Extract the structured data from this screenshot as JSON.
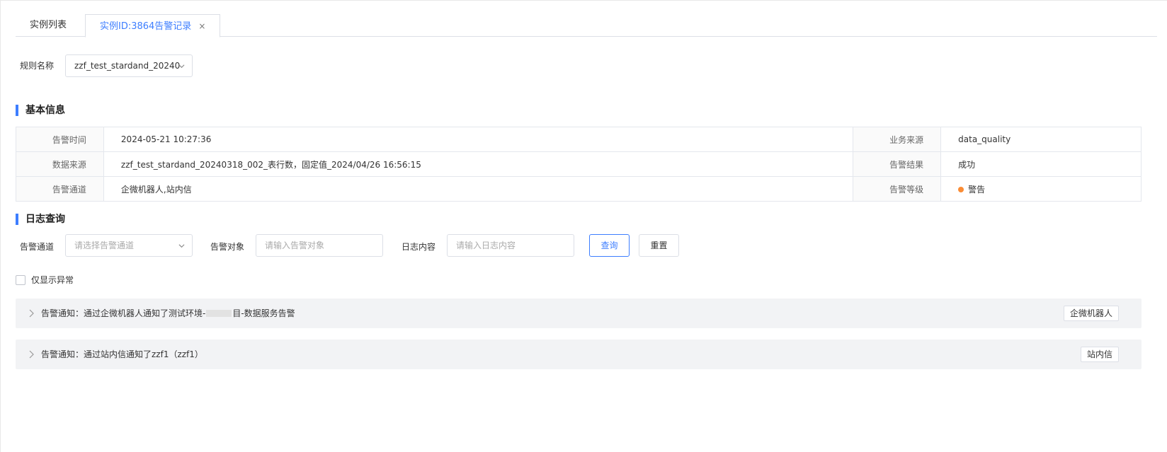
{
  "tabs": [
    {
      "label": "实例列表"
    },
    {
      "label": "实例ID:3864告警记录",
      "close": "×"
    }
  ],
  "rule": {
    "label": "规则名称",
    "value": "zzf_test_stardand_20240"
  },
  "basic_info": {
    "title": "基本信息",
    "rows": [
      {
        "label1": "告警时间",
        "value1": "2024-05-21 10:27:36",
        "label2": "业务来源",
        "value2": "data_quality"
      },
      {
        "label1": "数据来源",
        "value1": "zzf_test_stardand_20240318_002_表行数，固定值_2024/04/26 16:56:15",
        "label2": "告警结果",
        "value2": "成功"
      },
      {
        "label1": "告警通道",
        "value1": "企微机器人,站内信",
        "label2": "告警等级",
        "value2": "警告"
      }
    ],
    "level_color": "#fa8c35"
  },
  "log_query": {
    "title": "日志查询",
    "channel_label": "告警通道",
    "channel_placeholder": "请选择告警通道",
    "target_label": "告警对象",
    "target_placeholder": "请输入告警对象",
    "content_label": "日志内容",
    "content_placeholder": "请输入日志内容",
    "query_button": "查询",
    "reset_button": "重置",
    "only_abnormal_label": "仅显示异常"
  },
  "logs": [
    {
      "text_before": "告警通知：通过企微机器人通知了测试环境-",
      "text_after": "目-数据服务告警",
      "tag": "企微机器人"
    },
    {
      "text": "告警通知：通过站内信通知了zzf1（zzf1）",
      "tag": "站内信"
    }
  ],
  "accent_color": "#3d7eff"
}
